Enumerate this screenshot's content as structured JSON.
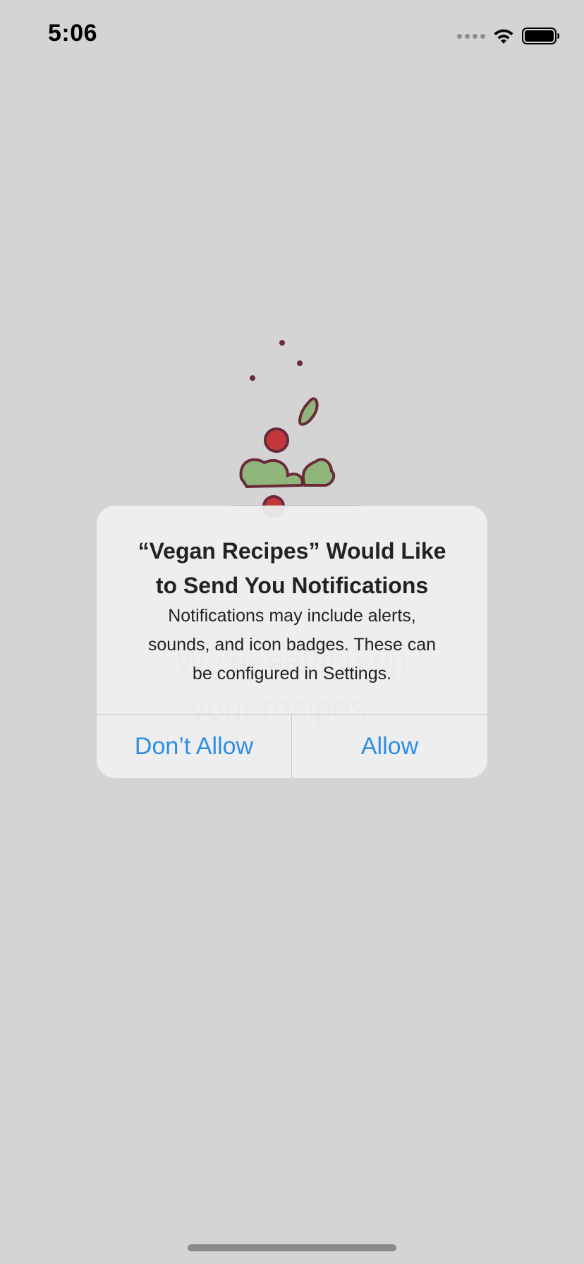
{
  "status_bar": {
    "time": "5:06",
    "icons": [
      "cellular-signal-icon",
      "wifi-icon",
      "battery-icon"
    ]
  },
  "splash": {
    "illustration": "salad-bowl-icon",
    "loading_text_lines": [
      "We're setting up",
      "your recipes..."
    ]
  },
  "alert": {
    "title_lines": [
      "“Vegan Recipes” Would Like",
      "to Send You Notifications"
    ],
    "message_lines": [
      "Notifications may include alerts,",
      "sounds, and icon badges. These can",
      "be configured in Settings."
    ],
    "deny_label": "Don’t Allow",
    "allow_label": "Allow"
  },
  "colors": {
    "background": "#d4d4d4",
    "accent": "#2e8fe5",
    "alert_bg": "#f2f2f2"
  }
}
